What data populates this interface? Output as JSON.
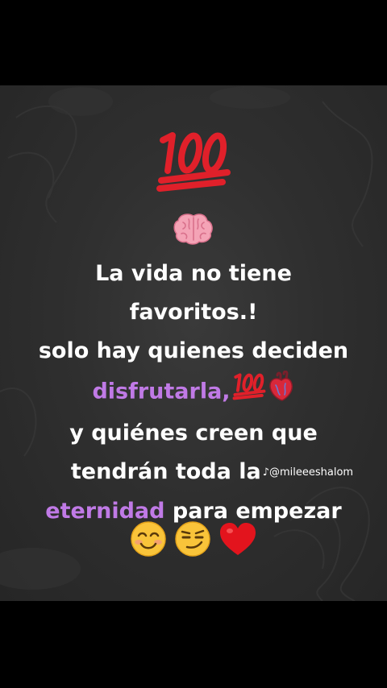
{
  "post": {
    "line1": "La vida no tiene",
    "line2": "favoritos.!",
    "line3": "solo hay quienes deciden",
    "line4_highlight": "disfrutarla,",
    "line5": "y quiénes creen que",
    "line6": "tendrán toda la",
    "line7_highlight": "eternidad",
    "line7_rest": " para empezar"
  },
  "watermark": {
    "handle": "@mileeeshalom",
    "logo_glyph": "♪"
  },
  "emojis": {
    "top": "hundred-points",
    "second": "brain",
    "after_line4": [
      "hundred-points",
      "anatomical-heart"
    ],
    "final": [
      "smiling-face",
      "smirking-face",
      "red-heart"
    ]
  },
  "colors": {
    "background": "#2f2f2f",
    "text": "#ffffff",
    "highlight": "#c07ae6",
    "hundred_red": "#e0202a",
    "heart_red": "#e3141d"
  }
}
